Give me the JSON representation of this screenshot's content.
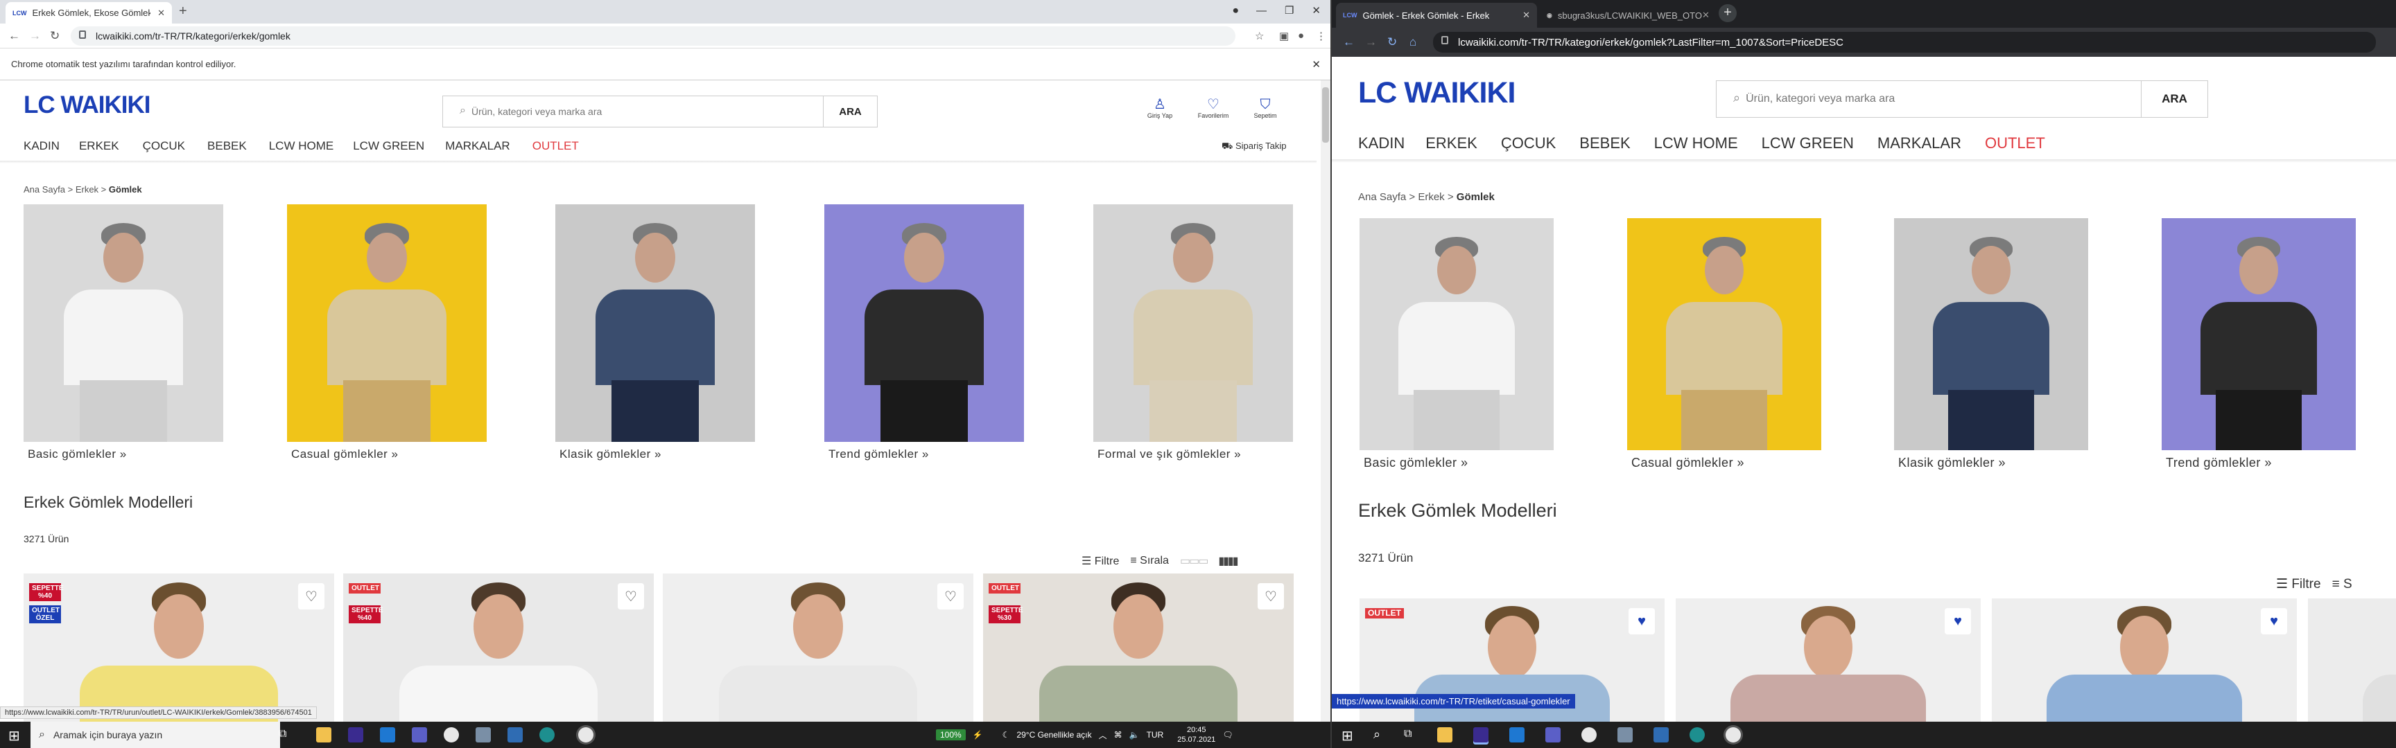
{
  "left": {
    "tab_title": "Erkek Gömlek, Ekose Gömlek, Slim",
    "favicon": "LCW",
    "url": "lcwaikiki.com/tr-TR/TR/kategori/erkek/gomlek",
    "infobar": "Chrome otomatik test yazılımı tarafından kontrol ediliyor.",
    "logo": "LC WAIKIKI",
    "search_placeholder": "Ürün, kategori veya marka ara",
    "search_button": "ARA",
    "header_icons": [
      {
        "label": "Giriş Yap",
        "icon": "user-icon"
      },
      {
        "label": "Favorilerim",
        "icon": "heart-icon"
      },
      {
        "label": "Sepetim",
        "icon": "bag-icon"
      }
    ],
    "menu": [
      "KADIN",
      "ERKEK",
      "ÇOCUK",
      "BEBEK",
      "LCW HOME",
      "LCW GREEN",
      "MARKALAR",
      "OUTLET"
    ],
    "siparis": "Sipariş Takip",
    "breadcrumb": [
      "Ana Sayfa",
      "Erkek",
      "Gömlek"
    ],
    "categories": [
      "Basic gömlekler »",
      "Casual gömlekler »",
      "Klasik gömlekler »",
      "Trend gömlekler »",
      "Formal ve şık gömlekler »"
    ],
    "heading": "Erkek Gömlek Modelleri",
    "count": "3271 Ürün",
    "filter_label": "Filtre",
    "sort_label": "Sırala",
    "badges": [
      [
        "SEPETTE %40",
        "OUTLET ÖZEL"
      ],
      [
        "OUTLET",
        "SEPETTE %40"
      ],
      [],
      [
        "OUTLET",
        "SEPETTE %30"
      ]
    ],
    "status_url": "https://www.lcwaikiki.com/tr-TR/TR/urun/outlet/LC-WAIKIKI/erkek/Gomlek/3883956/674501"
  },
  "right": {
    "tab1_title": "Gömlek - Erkek Gömlek - Erkek",
    "tab2_title": "sbugra3kus/LCWAIKIKI_WEB_OTO",
    "url": "lcwaikiki.com/tr-TR/TR/kategori/erkek/gomlek?LastFilter=m_1007&Sort=PriceDESC",
    "logo": "LC WAIKIKI",
    "search_placeholder": "Ürün, kategori veya marka ara",
    "search_button": "ARA",
    "menu": [
      "KADIN",
      "ERKEK",
      "ÇOCUK",
      "BEBEK",
      "LCW HOME",
      "LCW GREEN",
      "MARKALAR",
      "OUTLET"
    ],
    "breadcrumb": [
      "Ana Sayfa",
      "Erkek",
      "Gömlek"
    ],
    "categories": [
      "Basic gömlekler »",
      "Casual gömlekler »",
      "Klasik gömlekler »",
      "Trend gömlekler »"
    ],
    "heading": "Erkek Gömlek Modelleri",
    "count": "3271 Ürün",
    "filter_label": "Filtre",
    "sort_initial": "S",
    "outlet_badge": "OUTLET",
    "status_url": "https://www.lcwaikiki.com/tr-TR/TR/etiket/casual-gomlekler"
  },
  "taskbar": {
    "search_placeholder": "Aramak için buraya yazın",
    "battery": "100%",
    "weather": "29°C  Genellikle açık",
    "lang": "TUR",
    "time": "20:45",
    "date": "25.07.2021"
  },
  "colors": {
    "brand": "#1b3fb5",
    "outlet_red": "#e0393e",
    "badge_red": "#c8102e",
    "badge_blue": "#1b3fb5"
  }
}
